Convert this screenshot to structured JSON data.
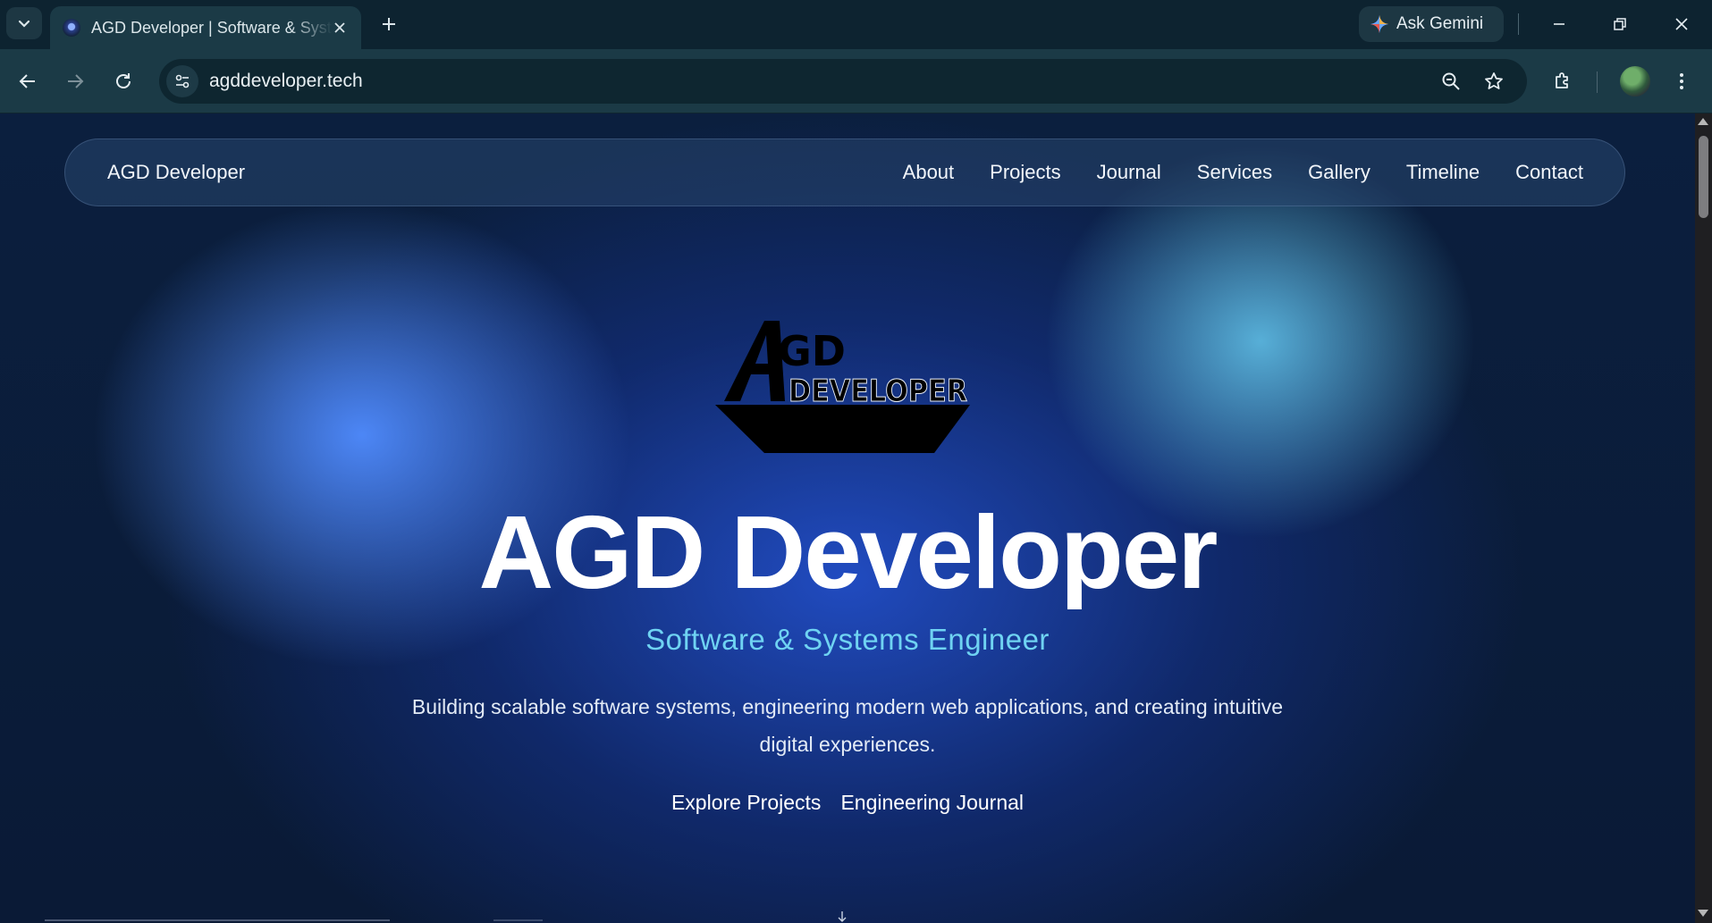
{
  "browser": {
    "tab_title": "AGD Developer | Software & Systems Engineer",
    "url": "agddeveloper.tech",
    "ask_gemini_label": "Ask Gemini"
  },
  "site": {
    "brand": "AGD Developer",
    "nav": [
      "About",
      "Projects",
      "Journal",
      "Services",
      "Gallery",
      "Timeline",
      "Contact"
    ],
    "logo": {
      "top_text": "GD",
      "bottom_text": "DEVELOPER"
    },
    "hero": {
      "title": "AGD Developer",
      "subtitle": "Software & Systems Engineer",
      "description": "Building scalable software systems, engineering modern web applications, and creating intuitive digital experiences.",
      "cta_primary": "Explore Projects",
      "cta_secondary": "Engineering Journal"
    }
  },
  "colors": {
    "chrome_bg": "#0d2330",
    "toolbar_bg": "#1b3a46",
    "hero_subtitle": "#6fd3f2",
    "page_bg": "#0b1f3e"
  }
}
